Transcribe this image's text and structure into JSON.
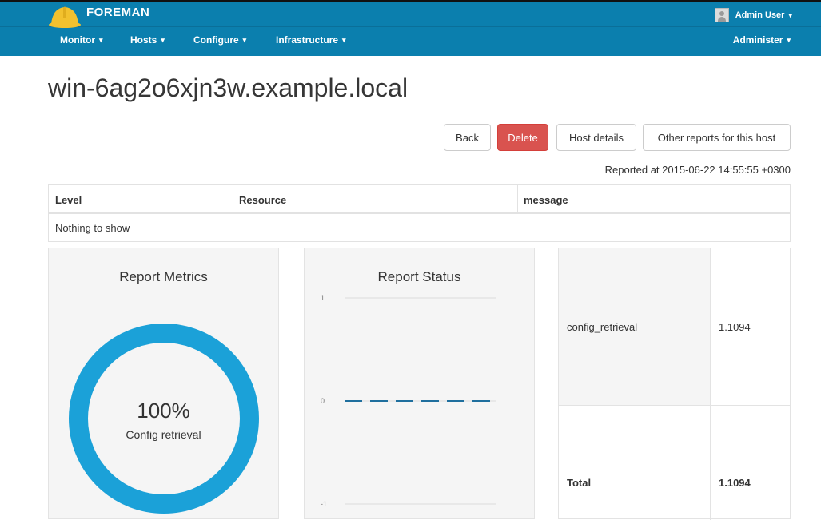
{
  "header": {
    "brand": "FOREMAN",
    "user": "Admin User",
    "nav": [
      "Monitor",
      "Hosts",
      "Configure",
      "Infrastructure"
    ],
    "admin": "Administer",
    "colors": {
      "bar": "#0b7fae",
      "helmet": "#f2c12e"
    }
  },
  "page": {
    "title": "win-6ag2o6xjn3w.example.local",
    "buttons": {
      "back": "Back",
      "delete": "Delete",
      "host_details": "Host details",
      "other_reports": "Other reports for this host"
    },
    "reported": "Reported at 2015-06-22 14:55:55 +0300"
  },
  "log_table": {
    "headers": [
      "Level",
      "Resource",
      "message"
    ],
    "empty": "Nothing to show"
  },
  "metrics_panel": {
    "title": "Report Metrics",
    "percent": "100%",
    "label": "Config retrieval",
    "color": "#1ba1d8"
  },
  "status_panel": {
    "title": "Report Status"
  },
  "chart_data": {
    "type": "line",
    "title": "Report Status",
    "yticks": [
      "1",
      "0",
      "-1"
    ],
    "ylim": [
      -1,
      1
    ],
    "series": [
      {
        "values": [
          0,
          0,
          0,
          0,
          0,
          0,
          0,
          0
        ]
      }
    ],
    "line_color": "#1f6f9e",
    "grid": true
  },
  "metrics_table": {
    "rows": [
      {
        "name": "config_retrieval",
        "value": "1.1094"
      },
      {
        "name": "Total",
        "value": "1.1094"
      }
    ]
  }
}
